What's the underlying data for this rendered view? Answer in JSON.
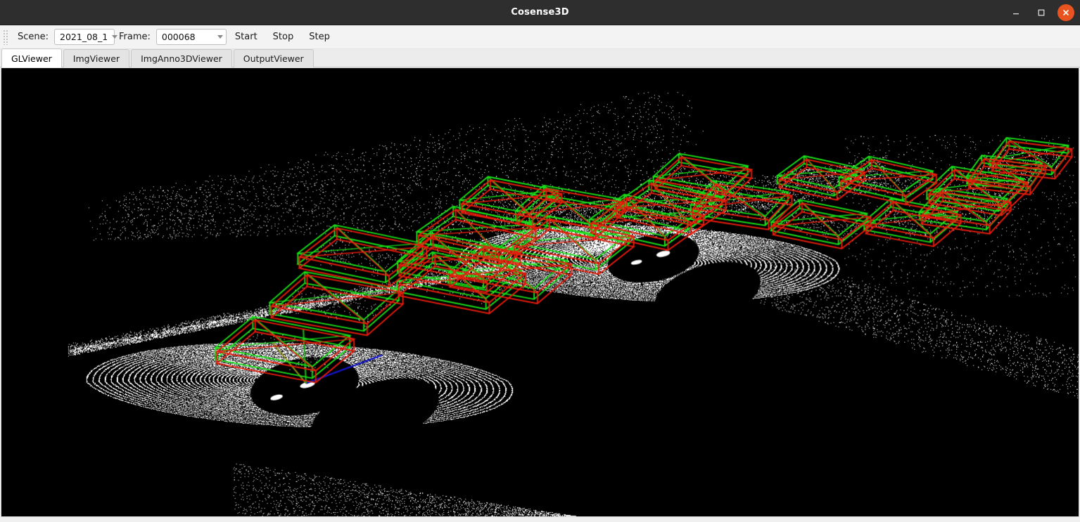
{
  "window": {
    "title": "Cosense3D",
    "controls": [
      {
        "name": "minimize-button",
        "icon": "minimize-icon"
      },
      {
        "name": "maximize-button",
        "icon": "maximize-icon"
      },
      {
        "name": "close-button",
        "icon": "close-icon"
      }
    ],
    "titlebar_bg": "#2e2e2e",
    "close_bg": "#e8531f"
  },
  "toolbar": {
    "scene_label": "Scene:",
    "scene_value": "2021_08_1",
    "frame_label": "Frame:",
    "frame_value": "000068",
    "start_label": "Start",
    "stop_label": "Stop",
    "step_label": "Step"
  },
  "tabs": [
    {
      "label": "GLViewer",
      "active": true
    },
    {
      "label": "ImgViewer",
      "active": false
    },
    {
      "label": "ImgAnno3DViewer",
      "active": false
    },
    {
      "label": "OutputViewer",
      "active": false
    }
  ],
  "viewer": {
    "background": "#000000",
    "point_color": "#ffffff",
    "gt_box_color": "#19e019",
    "pred_box_color": "#e81c0c",
    "axis_colors": {
      "x": "#1414c8",
      "y": "#8a8a14",
      "z": "#19a019"
    },
    "legend": {
      "green": "ground-truth 3D bounding box",
      "red": "predicted 3D bounding box"
    },
    "scene_type": "lidar-point-cloud",
    "num_boxes": 22,
    "sensors": [
      {
        "name": "ego-lidar-left",
        "cx": 0.275,
        "cy": 0.7
      },
      {
        "name": "cav-lidar-right",
        "cx": 0.6,
        "cy": 0.43
      }
    ],
    "boxes": [
      {
        "cx": 0.822,
        "cy": 0.259,
        "w": 0.034,
        "h": 0.03,
        "len": 0.028,
        "yaw": 0.52
      },
      {
        "cx": 0.905,
        "cy": 0.283,
        "w": 0.036,
        "h": 0.032,
        "len": 0.03,
        "yaw": 0.4
      },
      {
        "cx": 0.894,
        "cy": 0.328,
        "w": 0.033,
        "h": 0.03,
        "len": 0.028,
        "yaw": 0.35
      },
      {
        "cx": 0.76,
        "cy": 0.357,
        "w": 0.035,
        "h": 0.031,
        "len": 0.029,
        "yaw": 0.47
      },
      {
        "cx": 0.845,
        "cy": 0.353,
        "w": 0.034,
        "h": 0.03,
        "len": 0.029,
        "yaw": 0.44
      },
      {
        "cx": 0.76,
        "cy": 0.253,
        "w": 0.03,
        "h": 0.028,
        "len": 0.026,
        "yaw": 0.5
      },
      {
        "cx": 0.62,
        "cy": 0.32,
        "w": 0.039,
        "h": 0.034,
        "len": 0.032,
        "yaw": 0.52
      },
      {
        "cx": 0.598,
        "cy": 0.354,
        "w": 0.04,
        "h": 0.035,
        "len": 0.033,
        "yaw": 0.51
      },
      {
        "cx": 0.686,
        "cy": 0.315,
        "w": 0.037,
        "h": 0.033,
        "len": 0.03,
        "yaw": 0.36
      },
      {
        "cx": 0.65,
        "cy": 0.253,
        "w": 0.035,
        "h": 0.031,
        "len": 0.029,
        "yaw": 0.42
      },
      {
        "cx": 0.472,
        "cy": 0.307,
        "w": 0.036,
        "h": 0.032,
        "len": 0.03,
        "yaw": 0.45
      },
      {
        "cx": 0.44,
        "cy": 0.383,
        "w": 0.042,
        "h": 0.036,
        "len": 0.034,
        "yaw": 0.52
      },
      {
        "cx": 0.527,
        "cy": 0.33,
        "w": 0.039,
        "h": 0.034,
        "len": 0.032,
        "yaw": 0.42
      },
      {
        "cx": 0.53,
        "cy": 0.405,
        "w": 0.043,
        "h": 0.037,
        "len": 0.035,
        "yaw": 0.47
      },
      {
        "cx": 0.424,
        "cy": 0.445,
        "w": 0.044,
        "h": 0.038,
        "len": 0.036,
        "yaw": 0.44
      },
      {
        "cx": 0.426,
        "cy": 0.49,
        "w": 0.046,
        "h": 0.039,
        "len": 0.037,
        "yaw": 0.46
      },
      {
        "cx": 0.471,
        "cy": 0.47,
        "w": 0.044,
        "h": 0.038,
        "len": 0.036,
        "yaw": 0.44
      },
      {
        "cx": 0.334,
        "cy": 0.43,
        "w": 0.046,
        "h": 0.039,
        "len": 0.037,
        "yaw": 0.48
      },
      {
        "cx": 0.31,
        "cy": 0.537,
        "w": 0.048,
        "h": 0.041,
        "len": 0.039,
        "yaw": 0.43
      },
      {
        "cx": 0.262,
        "cy": 0.64,
        "w": 0.05,
        "h": 0.042,
        "len": 0.04,
        "yaw": 0.45
      },
      {
        "cx": 0.955,
        "cy": 0.209,
        "w": 0.03,
        "h": 0.028,
        "len": 0.026,
        "yaw": 0.3
      },
      {
        "cx": 0.932,
        "cy": 0.246,
        "w": 0.029,
        "h": 0.027,
        "len": 0.025,
        "yaw": 0.28
      }
    ]
  }
}
